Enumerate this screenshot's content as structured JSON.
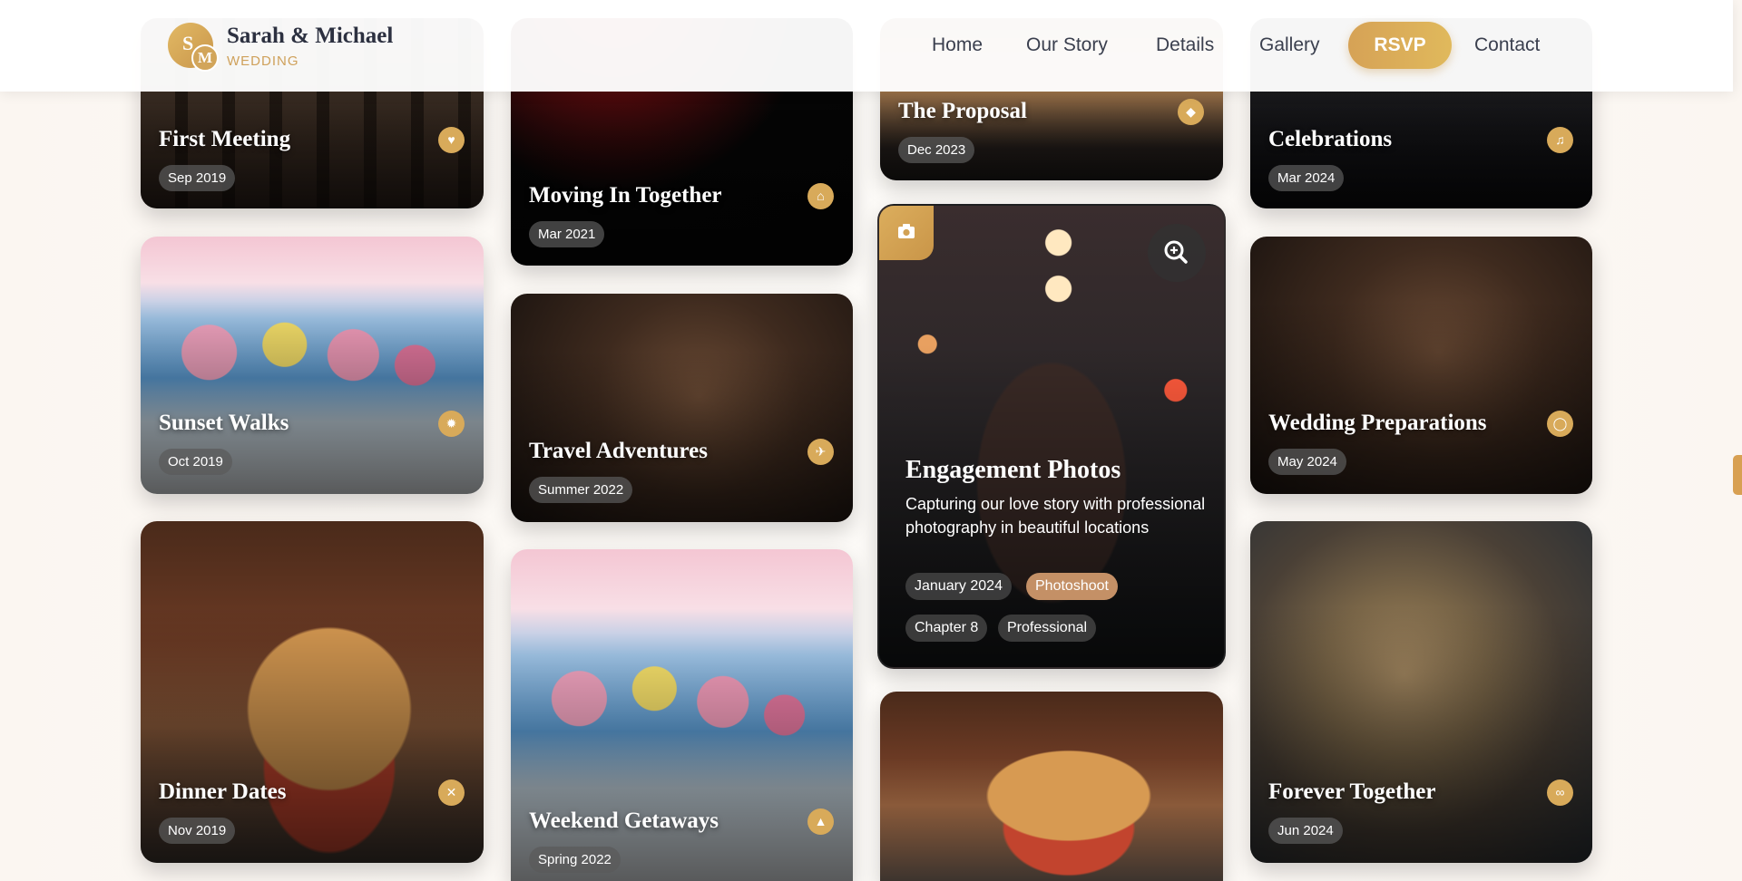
{
  "header": {
    "logo_letters": {
      "first": "S",
      "second": "M"
    },
    "brand_name": "Sarah & Michael",
    "brand_sub": "WEDDING",
    "nav": {
      "home": "Home",
      "our_story": "Our Story",
      "details": "Details",
      "gallery": "Gallery",
      "rsvp": "RSVP",
      "contact": "Contact"
    }
  },
  "gallery": {
    "first_meeting": {
      "title": "First Meeting",
      "date": "Sep 2019",
      "icon": "heart-icon"
    },
    "moving_in": {
      "title": "Moving In Together",
      "date": "Mar 2021",
      "icon": "home-icon"
    },
    "proposal": {
      "title": "The Proposal",
      "date": "Dec 2023",
      "icon": "diamond-icon"
    },
    "celebrations": {
      "title": "Celebrations",
      "date": "Mar 2024",
      "icon": "glasses-icon"
    },
    "sunset_walks": {
      "title": "Sunset Walks",
      "date": "Oct 2019",
      "icon": "sun-icon"
    },
    "travel": {
      "title": "Travel Adventures",
      "date": "Summer 2022",
      "icon": "plane-icon"
    },
    "wedding_prep": {
      "title": "Wedding Preparations",
      "date": "May 2024",
      "icon": "ring-icon"
    },
    "dinner_dates": {
      "title": "Dinner Dates",
      "date": "Nov 2019",
      "icon": "utensils-icon"
    },
    "weekend": {
      "title": "Weekend Getaways",
      "date": "Spring 2022",
      "icon": "mountain-icon"
    },
    "forever": {
      "title": "Forever Together",
      "date": "Jun 2024",
      "icon": "infinity-icon"
    },
    "featured": {
      "title": "Engagement Photos",
      "description": "Capturing our love story with professional photography in beautiful locations",
      "tags": {
        "date": "January 2024",
        "category": "Photoshoot",
        "chapter": "Chapter 8",
        "style": "Professional"
      }
    }
  },
  "colors": {
    "accent": "#d8aa5a",
    "text_dark": "#2c3040"
  }
}
